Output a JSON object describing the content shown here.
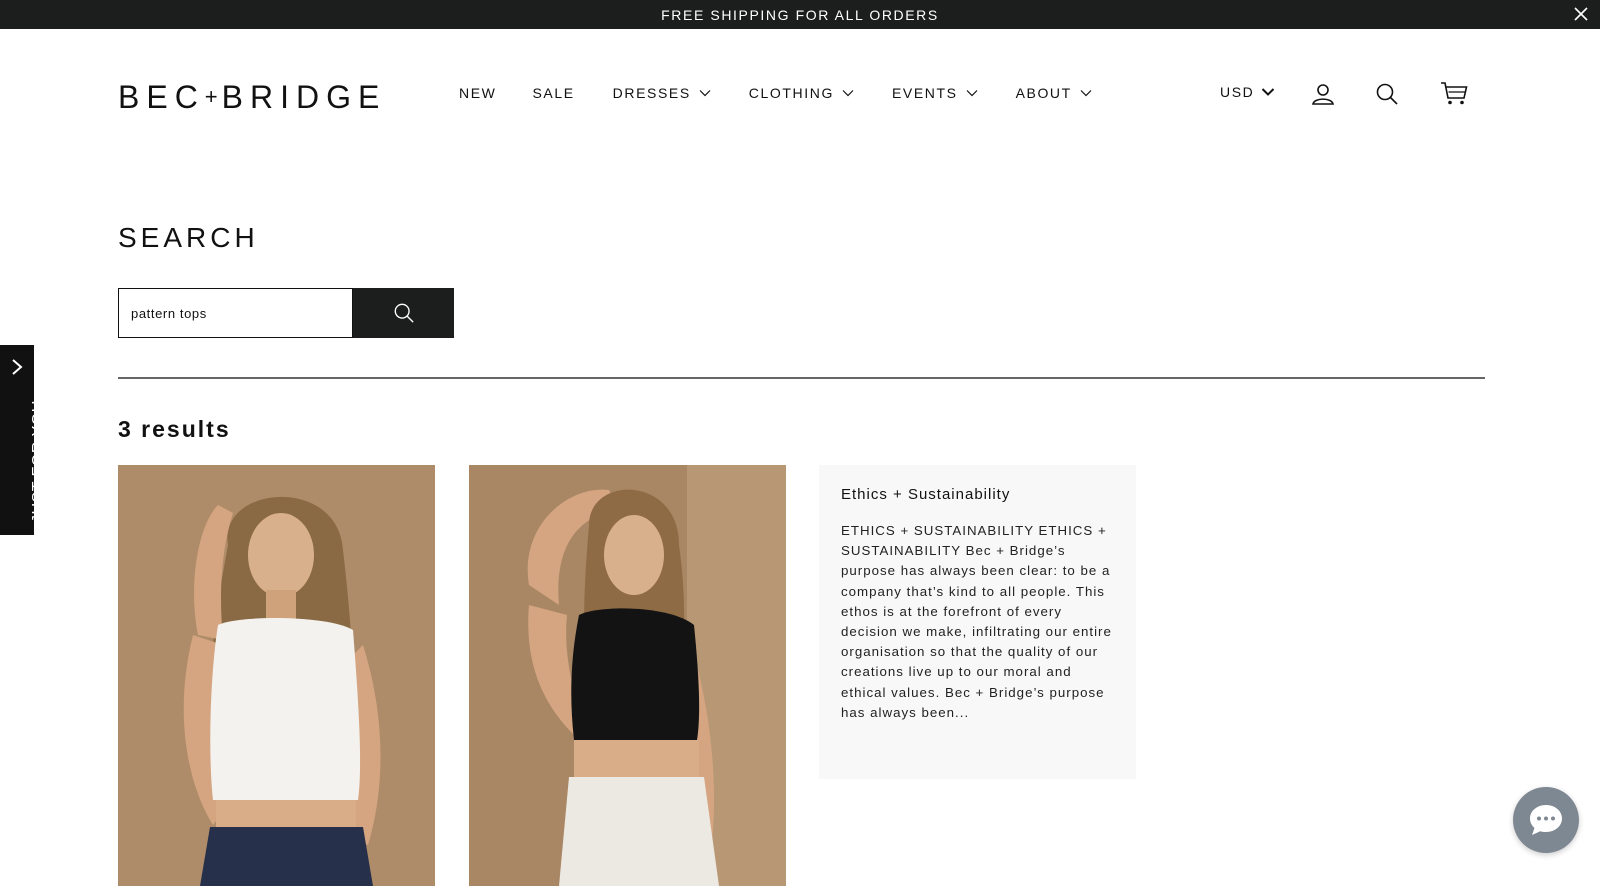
{
  "announcement": {
    "text": "FREE SHIPPING FOR ALL ORDERS"
  },
  "header": {
    "logo_left": "BEC",
    "logo_plus": "+",
    "logo_right": "BRIDGE",
    "nav": [
      {
        "label": "NEW",
        "has_dropdown": false
      },
      {
        "label": "SALE",
        "has_dropdown": false
      },
      {
        "label": "DRESSES",
        "has_dropdown": true
      },
      {
        "label": "CLOTHING",
        "has_dropdown": true
      },
      {
        "label": "EVENTS",
        "has_dropdown": true
      },
      {
        "label": "ABOUT",
        "has_dropdown": true
      }
    ],
    "currency": "USD",
    "icons": [
      "account-icon",
      "search-icon",
      "cart-icon"
    ]
  },
  "search": {
    "title": "SEARCH",
    "query": "pattern tops",
    "results_count": "3 results"
  },
  "results": {
    "products": [
      {
        "image": "model in white sleeveless knit crop top"
      },
      {
        "image": "model in black sleeveless knit crop top"
      }
    ],
    "page": {
      "title": "Ethics + Sustainability",
      "excerpt": "ETHICS + SUSTAINABILITY ETHICS + SUSTAINABILITY Bec + Bridge’s purpose has always been clear: to be a company that’s kind to all people.  This ethos is at the forefront of every decision we make, infiltrating our entire organisation so that the quality of our creations live up to our moral and ethical values. Bec + Bridge’s purpose has always been..."
    }
  },
  "side_tab": {
    "label": "JUST FOR YOU"
  },
  "colors": {
    "dark": "#1c1d1d",
    "page_card_bg": "#f8f8f8",
    "chat": "#7e8893",
    "photo_bg": "#b3916c"
  }
}
